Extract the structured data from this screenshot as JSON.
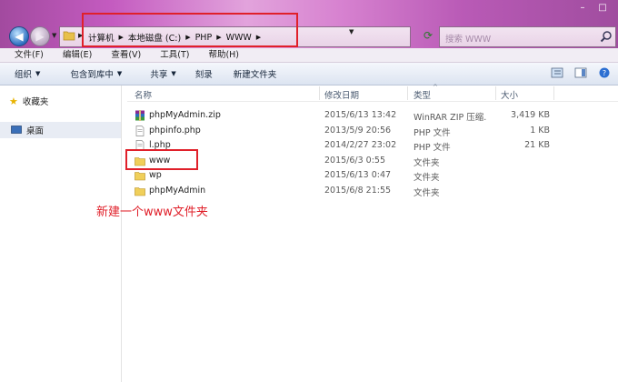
{
  "window": {
    "minimize": "–",
    "maximize": "□"
  },
  "address": {
    "crumbs": [
      "计算机",
      "本地磁盘 (C:)",
      "PHP",
      "WWW"
    ]
  },
  "search": {
    "placeholder": "搜索 WWW"
  },
  "menu": [
    "文件(F)",
    "编辑(E)",
    "查看(V)",
    "工具(T)",
    "帮助(H)"
  ],
  "toolbar": {
    "organize": "组织",
    "include": "包含到库中",
    "share": "共享",
    "burn": "刻录",
    "new_folder": "新建文件夹"
  },
  "sidebar": {
    "favorites": "收藏夹",
    "desktop": "桌面"
  },
  "columns": {
    "name": "名称",
    "date": "修改日期",
    "type": "类型",
    "size": "大小"
  },
  "files": [
    {
      "name": "phpMyAdmin.zip",
      "date": "2015/6/13 13:42",
      "type": "WinRAR ZIP 压缩...",
      "size": "3,419 KB",
      "icon": "winrar-zip-icon"
    },
    {
      "name": "phpinfo.php",
      "date": "2013/5/9 20:56",
      "type": "PHP 文件",
      "size": "1 KB",
      "icon": "php-file-icon"
    },
    {
      "name": "l.php",
      "date": "2014/2/27 23:02",
      "type": "PHP 文件",
      "size": "21 KB",
      "icon": "php-file-icon"
    },
    {
      "name": "www",
      "date": "2015/6/3 0:55",
      "type": "文件夹",
      "size": "",
      "icon": "folder-icon"
    },
    {
      "name": "wp",
      "date": "2015/6/13 0:47",
      "type": "文件夹",
      "size": "",
      "icon": "folder-icon"
    },
    {
      "name": "phpMyAdmin",
      "date": "2015/6/8 21:55",
      "type": "文件夹",
      "size": "",
      "icon": "folder-icon"
    }
  ],
  "annotation": "新建一个www文件夹",
  "colors": {
    "highlight": "#e0202a",
    "title_gradient_mid": "#e2a3dc"
  }
}
